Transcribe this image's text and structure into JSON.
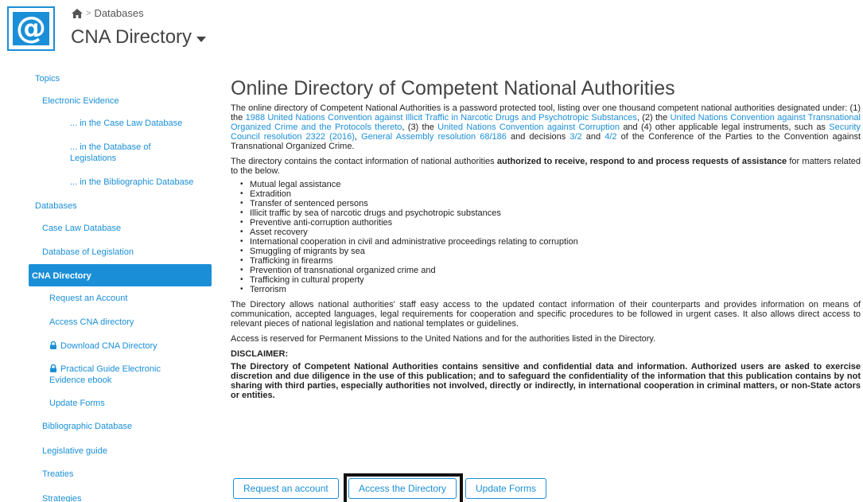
{
  "header": {
    "logo_text": "@",
    "breadcrumb": "Databases",
    "site_title": "CNA Directory"
  },
  "sidebar": {
    "items": [
      {
        "label": "Topics"
      },
      {
        "label": "Electronic Evidence"
      },
      {
        "label": "... in the Case Law Database"
      },
      {
        "label": "... in the Database of Legislations"
      },
      {
        "label": "... in the Bibliographic Database"
      },
      {
        "label": "Databases"
      },
      {
        "label": "Case Law Database"
      },
      {
        "label": "Database of Legislation"
      },
      {
        "label": "CNA Directory"
      },
      {
        "label": "Request an Account"
      },
      {
        "label": "Access CNA directory"
      },
      {
        "label": "Download CNA Directory"
      },
      {
        "label": "Practical Guide Electronic Evidence ebook"
      },
      {
        "label": "Update Forms"
      },
      {
        "label": "Bibliographic Database"
      },
      {
        "label": "Legislative guide"
      },
      {
        "label": "Treaties"
      },
      {
        "label": "Strategies"
      }
    ]
  },
  "main": {
    "title": "Online Directory of Competent National Authorities",
    "p1": {
      "a": "The online directory of Competent National Authorities is a password protected tool, listing over one thousand competent national authorities designated under: (1) the ",
      "l1": "1988 United Nations Convention against Illicit Traffic in Narcotic Drugs and Psychotropic Substances",
      "b": ", (2) the ",
      "l2": "United Nations Convention against Transnational Organized Crime and the Protocols thereto",
      "c": ", (3) the ",
      "l3": "United Nations Convention against Corruption",
      "d": " and (4) other applicable legal instruments, such as ",
      "l4": "Security Council resolution 2322 (2016)",
      "e": ", ",
      "l5": "General Assembly resolution 68/186",
      "f": " and decisions ",
      "l6": "3/2",
      "g": " and ",
      "l7": "4/2",
      "h": " of the Conference of the Parties to the Convention against Transnational Organized Crime."
    },
    "p2": {
      "a": "The directory contains the contact information of national authorities ",
      "bold1": "authorized to receive, respond to and process requests of assistance",
      "b": " for matters related to the below."
    },
    "list": [
      "Mutual legal assistance",
      "Extradition",
      "Transfer of sentenced persons",
      "Illicit traffic by sea of narcotic drugs and psychotropic substances",
      "Preventive anti-corruption authorities",
      "Asset recovery",
      "International cooperation in civil and administrative proceedings relating to corruption",
      "Smuggling of migrants by sea",
      "Trafficking in firearms",
      "Prevention of transnational organized crime and",
      "Trafficking in cultural property",
      "Terrorism"
    ],
    "p3": "The Directory allows national authorities' staff easy access to the updated contact information of their counterparts and provides information on means of communication, accepted languages, legal requirements for cooperation and specific procedures to be followed in urgent cases. It also allows direct access to relevant pieces of national legislation and national templates or guidelines.",
    "p4": "Access is reserved for Permanent Missions to the United Nations and for the authorities listed in the Directory.",
    "disclaimer_heading": "DISCLAIMER:",
    "disclaimer": "The Directory of Competent National Authorities contains sensitive and confidential data and information. Authorized users are asked to exercise discretion and due diligence in the use of this publication; and to safeguard the confidentiality of the information that this publication contains by not sharing with third parties, especially authorities not involved, directly or indirectly, in international cooperation in criminal matters, or non-State actors or entities."
  },
  "buttons": {
    "request": "Request an account",
    "access": "Access the Directory",
    "update": "Update Forms"
  },
  "colors": {
    "accent": "#1a8fd8"
  }
}
